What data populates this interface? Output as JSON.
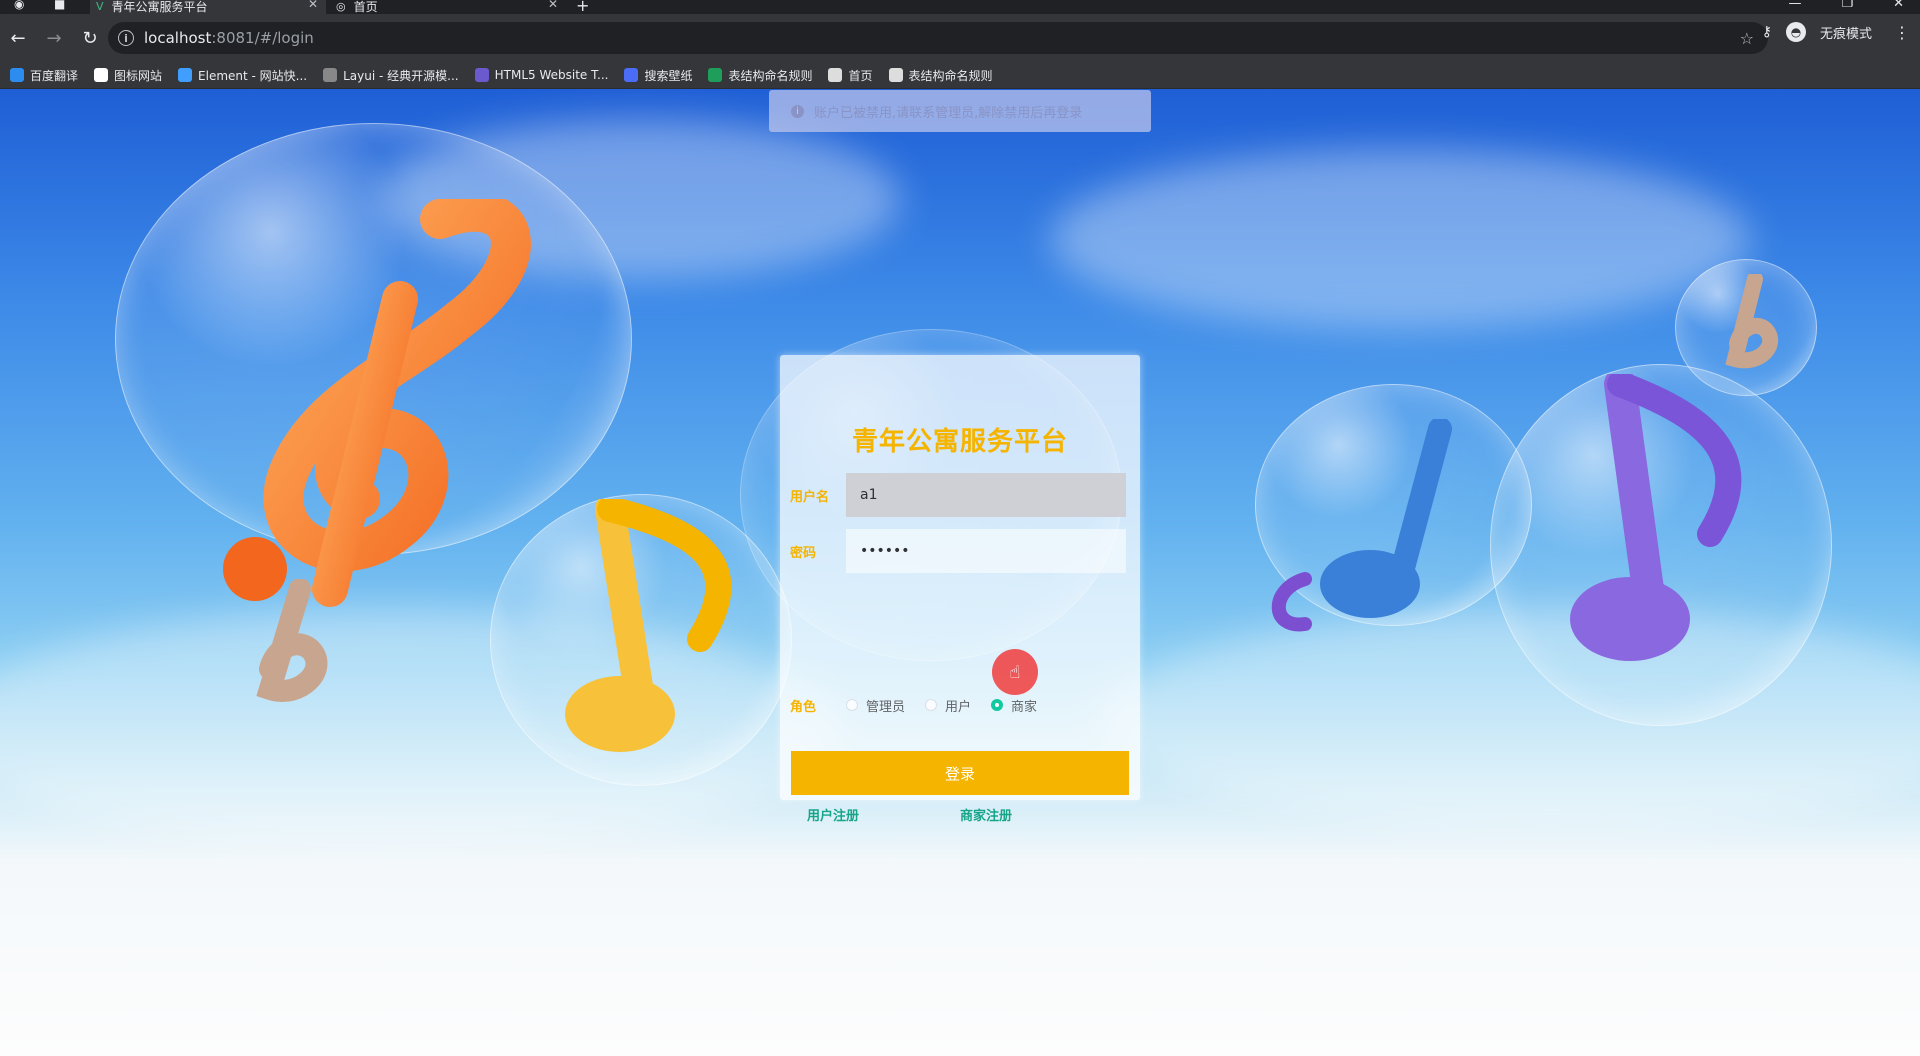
{
  "browser": {
    "tabs": [
      {
        "title": "青年公寓服务平台",
        "active": true
      },
      {
        "title": "首页",
        "active": false
      }
    ],
    "new_tab": "+",
    "url_host": "localhost",
    "url_path": ":8081/#/login",
    "incognito_label": "无痕模式",
    "bookmarks": [
      {
        "label": "百度翻译",
        "icon": "translate-icon",
        "color": "#2d8cf0"
      },
      {
        "label": "图标网站",
        "icon": "flag-icon",
        "color": "#ffffff"
      },
      {
        "label": "Element - 网站快...",
        "icon": "element-icon",
        "color": "#409eff"
      },
      {
        "label": "Layui - 经典开源模...",
        "icon": "layui-icon",
        "color": "#888888"
      },
      {
        "label": "HTML5 Website T...",
        "icon": "html5-icon",
        "color": "#6a5acd"
      },
      {
        "label": "搜索壁纸",
        "icon": "wallpaper-icon",
        "color": "#4a6cf7"
      },
      {
        "label": "表结构命名规则",
        "icon": "sheet-icon",
        "color": "#1e9e5a"
      },
      {
        "label": "首页",
        "icon": "globe-icon",
        "color": "#dddddd"
      },
      {
        "label": "表结构命名规则",
        "icon": "globe-icon",
        "color": "#dddddd"
      }
    ]
  },
  "toast": {
    "message": "账户已被禁用,请联系管理员,解除禁用后再登录"
  },
  "login": {
    "title": "青年公寓服务平台",
    "username_label": "用户名",
    "username_value": "a1",
    "password_label": "密码",
    "password_value": "123456",
    "role_label": "角色",
    "roles": [
      {
        "label": "管理员",
        "checked": false
      },
      {
        "label": "用户",
        "checked": false
      },
      {
        "label": "商家",
        "checked": true
      }
    ],
    "submit_label": "登录",
    "register_user": "用户注册",
    "register_merchant": "商家注册"
  },
  "colors": {
    "accent": "#f5b400",
    "link": "#17a589",
    "radio_checked": "#13c9a0"
  }
}
